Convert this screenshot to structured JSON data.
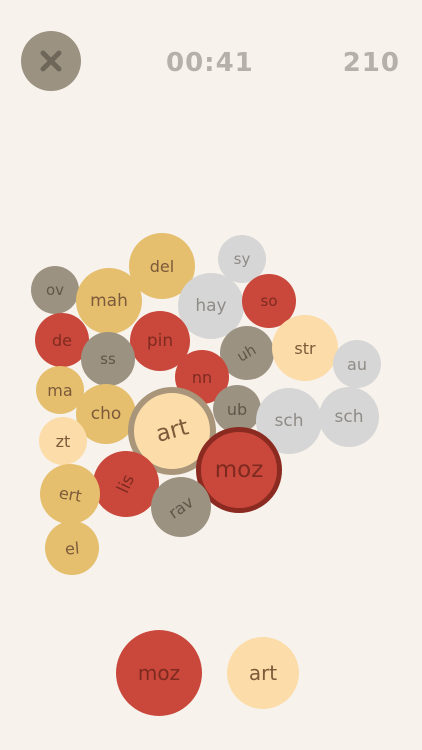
{
  "header": {
    "close_icon": "close-icon",
    "timer": "00:41",
    "score": "210"
  },
  "colors": {
    "background": "#f7f2ec",
    "red": "#c9483b",
    "gold": "#e5bf6e",
    "light_orange": "#fcdca8",
    "taupe": "#9c9281",
    "gray": "#d6d6d6",
    "text_dark": "#7c5a3a"
  },
  "board": {
    "bubbles": [
      {
        "text": "ov",
        "color": "taupe"
      },
      {
        "text": "del",
        "color": "gold"
      },
      {
        "text": "sy",
        "color": "gray"
      },
      {
        "text": "mah",
        "color": "gold"
      },
      {
        "text": "hay",
        "color": "gray"
      },
      {
        "text": "so",
        "color": "red"
      },
      {
        "text": "de",
        "color": "red"
      },
      {
        "text": "pin",
        "color": "red"
      },
      {
        "text": "ss",
        "color": "taupe"
      },
      {
        "text": "uh",
        "color": "taupe"
      },
      {
        "text": "str",
        "color": "light_orange"
      },
      {
        "text": "au",
        "color": "gray"
      },
      {
        "text": "ma",
        "color": "gold"
      },
      {
        "text": "nn",
        "color": "red"
      },
      {
        "text": "cho",
        "color": "gold"
      },
      {
        "text": "ub",
        "color": "taupe"
      },
      {
        "text": "sch",
        "color": "gray"
      },
      {
        "text": "sch",
        "color": "gray"
      },
      {
        "text": "zt",
        "color": "light_orange"
      },
      {
        "text": "art",
        "color": "light_orange",
        "selected": true
      },
      {
        "text": "moz",
        "color": "red",
        "selected": true
      },
      {
        "text": "lis",
        "color": "red"
      },
      {
        "text": "ert",
        "color": "gold"
      },
      {
        "text": "rav",
        "color": "taupe"
      },
      {
        "text": "el",
        "color": "gold"
      }
    ]
  },
  "word_tray": {
    "slots": [
      {
        "text": "moz",
        "color": "red"
      },
      {
        "text": "art",
        "color": "light_orange"
      }
    ]
  }
}
